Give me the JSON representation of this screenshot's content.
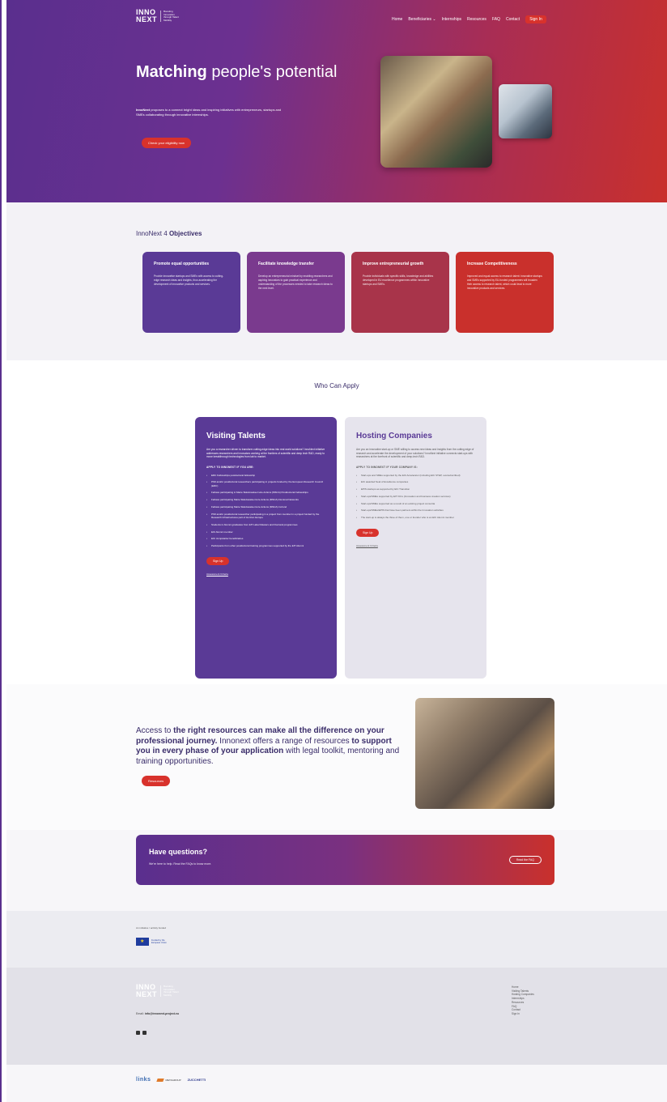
{
  "brand": {
    "logo_mark_top": "INNO",
    "logo_mark_bottom": "NEXT",
    "logo_text": "Boosting Innovation through Talent Mobility"
  },
  "nav": {
    "items": [
      "Home",
      "Beneficiaries ⌄",
      "Internships",
      "Resources",
      "FAQ",
      "Contact"
    ],
    "signin": "Sign In"
  },
  "hero": {
    "title_bold": "Matching",
    "title_rest": "people's potential",
    "lead_bold": "InnoNext",
    "lead_rest": "proposes to a connect bright ideas and inspiring initiatives with entrepreneurs, startups and SMEs collaborating through innovative internships.",
    "cta": "Check your eligibility now"
  },
  "objectives": {
    "title_light": "InnoNext 4",
    "title_bold": "Objectives",
    "cards": [
      {
        "title": "Promote equal opportunities",
        "text": "Provide innovative startups and SMEs with access to cutting-edge research ideas and insights, thus accelerating the development of innovative products and services.",
        "color": "#5a3a96"
      },
      {
        "title": "Facilitate knowledge transfer",
        "text": "Develop an entrepreneurial mindset by enabling researchers and aspiring innovators to gain practical experience and understanding of the processes needed to take research ideas to the next level.",
        "color": "#7a3a8e"
      },
      {
        "title": "Improve entrepreneurial growth",
        "text": "Provide individuals with specific skills, knowledge and abilities developed in EU excellence programmes within innovative startups and SMEs.",
        "color": "#a8344a"
      },
      {
        "title": "Increase Competitiveness",
        "text": "Improved and equal access to research talent: innovative startups and SMEs supported by EU-funded programmes will broaden their access to research talent, which could lead to more innovative products and services.",
        "color": "#c9302c"
      }
    ]
  },
  "who": {
    "title": "Who Can Apply",
    "visiting": {
      "title": "Visiting Talents",
      "desc": "Are you a researcher driven to transform cutting-edge ideas into real world solutions? InnoNext initiative addresses researchers and innovators working at the frontiers of scientific and deep tech R&D, ready to move breakthrough technologies from lab to market.",
      "sub": "APPLY TO INNONEXT IF YOU ARE:",
      "items": [
        "ERC Fellowships postdoctoral fellowship",
        "PhD and/or postdoctoral researchers participating in projects funded by the European Research Council (ERC)",
        "Fellows participating in Marie Skłodowska-Curie Actions (MSCA) Postdoctoral Fellowships",
        "Fellows participating Marie Skłodowska-Curie Actions (MSCA) Doctoral Networks",
        "Fellows participating Marie Skłodowska-Curie Actions (MSCA) Cofund",
        "PhD and/or postdoctoral researcher participating in a project from member in a project funded by the Research Infrastructures part of Horizon Europe",
        "Students in Alumni graduates from EIT Label Masters and Doctoral programmes",
        "EIC Alumni member",
        "EIC Jumpstarter beneficiaries",
        "Participants from other postdoctoral training programmes supported by the EIT Alumni"
      ],
      "cta": "Sign Up",
      "link": "Assessment Criteria"
    },
    "hosting": {
      "title": "Hosting Companies",
      "desc": "Are you an innovative start-up or SME willing to access new ideas and insights from the cutting edge of research and accelerate the development of your solutions? InnoNext initiative connects start-ups with researchers at the forefront of scientific and deep-tech R&D.",
      "sub": "APPLY TO INNONEXT IF YOUR COMPANY IS:",
      "items": [
        "Start-ups and SMEs supported by the EIC Accelerator (including EIC STEP, oversubscribed)",
        "EIC awarded Seal of Excellence companies",
        "EPIS startups as supported by EIC Transition",
        "Start-ups/SMEs supported by EIT KICs (Innovation and business creation services)",
        "Start-ups/SMEs supported as a result of an existing project consortia",
        "Start-ups/SMEs/EPIS that have been partners within the Innovation activities",
        "The start-up is always the three of them, one or founder who is an EIC Alumni member"
      ],
      "cta": "Sign Up",
      "link": "Assessment Criteria"
    }
  },
  "resources": {
    "text_light_1": "Access to",
    "text_bold_1": "the right resources can make all the difference on your professional journey.",
    "text_light_2": "Innonext offers a range of resources",
    "text_bold_2": "to support you in every phase of your application",
    "text_light_3": "with legal toolkit, mentoring and training opportunities.",
    "cta": "Resources"
  },
  "faq": {
    "title": "Have questions?",
    "text": "We're here to help. Read the FAQs to know more.",
    "cta": "Read the FAQ"
  },
  "funding": {
    "label": "An initiative / activity funded",
    "eu_text": "Funded by the European Union"
  },
  "footer": {
    "email_label": "Email:",
    "email": "info@innonext-project.eu",
    "links": [
      "Home",
      "Visiting Talents",
      "Hosting Companies",
      "Internships",
      "Resources",
      "FAQ",
      "Contact",
      "Sign In"
    ]
  },
  "partners": {
    "links": "links",
    "meta": "METAGROUP",
    "succ": "ZUCCHETTI"
  }
}
